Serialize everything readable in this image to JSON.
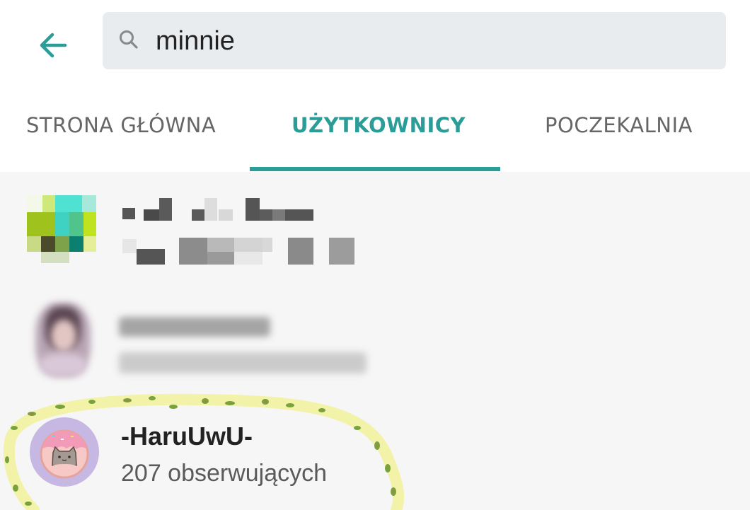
{
  "search": {
    "query": "minnie"
  },
  "tabs": [
    {
      "label": "STRONA GŁÓWNA",
      "active": false
    },
    {
      "label": "UŻYTKOWNICY",
      "active": true
    },
    {
      "label": "POCZEKALNIA",
      "active": false
    }
  ],
  "users": [
    {
      "name": "-HaruUwU-",
      "followers": "207 obserwujących",
      "highlighted": true
    }
  ],
  "colors": {
    "accent": "#2a9d98",
    "avatar_bg": "#c7b7e3",
    "highlight": "#f2f2a8"
  }
}
